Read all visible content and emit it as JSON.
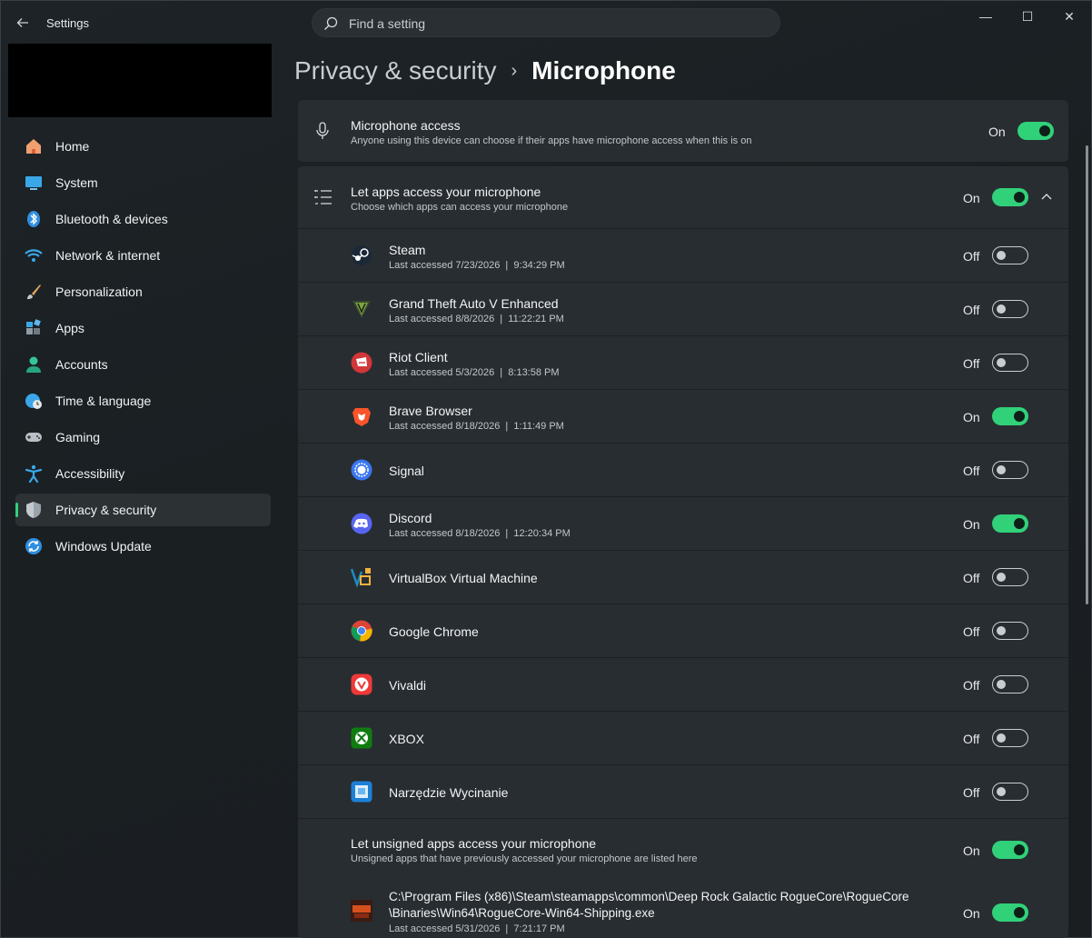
{
  "window": {
    "app_title": "Settings",
    "back_icon": "back-arrow-icon",
    "controls": {
      "minimize": "—",
      "maximize": "☐",
      "close": "✕"
    }
  },
  "search": {
    "placeholder": "Find a setting"
  },
  "sidebar": {
    "items": [
      {
        "label": "Home",
        "icon": "home-icon"
      },
      {
        "label": "System",
        "icon": "system-icon"
      },
      {
        "label": "Bluetooth & devices",
        "icon": "bluetooth-icon"
      },
      {
        "label": "Network & internet",
        "icon": "wifi-icon"
      },
      {
        "label": "Personalization",
        "icon": "brush-icon"
      },
      {
        "label": "Apps",
        "icon": "apps-icon"
      },
      {
        "label": "Accounts",
        "icon": "account-icon"
      },
      {
        "label": "Time & language",
        "icon": "globe-clock-icon"
      },
      {
        "label": "Gaming",
        "icon": "gamepad-icon"
      },
      {
        "label": "Accessibility",
        "icon": "accessibility-icon"
      },
      {
        "label": "Privacy & security",
        "icon": "shield-icon",
        "active": true
      },
      {
        "label": "Windows Update",
        "icon": "update-icon"
      }
    ]
  },
  "breadcrumb": {
    "parent": "Privacy & security",
    "separator": "›",
    "current": "Microphone"
  },
  "microphone_access": {
    "title": "Microphone access",
    "subtitle": "Anyone using this device can choose if their apps have microphone access when this is on",
    "state": "On"
  },
  "let_apps": {
    "title": "Let apps access your microphone",
    "subtitle": "Choose which apps can access your microphone",
    "state": "On",
    "expand_icon": "chevron-up-icon"
  },
  "apps": [
    {
      "name": "Steam",
      "last": "Last accessed 7/23/2026  |  9:34:29 PM",
      "state": "Off",
      "icon": "steam-icon"
    },
    {
      "name": "Grand Theft Auto V Enhanced",
      "last": "Last accessed 8/8/2026  |  11:22:21 PM",
      "state": "Off",
      "icon": "gta-icon"
    },
    {
      "name": "Riot Client",
      "last": "Last accessed 5/3/2026  |  8:13:58 PM",
      "state": "Off",
      "icon": "riot-icon"
    },
    {
      "name": "Brave Browser",
      "last": "Last accessed 8/18/2026  |  1:11:49 PM",
      "state": "On",
      "icon": "brave-icon"
    },
    {
      "name": "Signal",
      "last": "",
      "state": "Off",
      "icon": "signal-icon"
    },
    {
      "name": "Discord",
      "last": "Last accessed 8/18/2026  |  12:20:34 PM",
      "state": "On",
      "icon": "discord-icon"
    },
    {
      "name": "VirtualBox Virtual Machine",
      "last": "",
      "state": "Off",
      "icon": "virtualbox-icon"
    },
    {
      "name": "Google Chrome",
      "last": "",
      "state": "Off",
      "icon": "chrome-icon"
    },
    {
      "name": "Vivaldi",
      "last": "",
      "state": "Off",
      "icon": "vivaldi-icon"
    },
    {
      "name": "XBOX",
      "last": "",
      "state": "Off",
      "icon": "xbox-icon"
    },
    {
      "name": "Narzędzie Wycinanie",
      "last": "",
      "state": "Off",
      "icon": "snipping-tool-icon"
    }
  ],
  "unsigned": {
    "title": "Let unsigned apps access your microphone",
    "subtitle": "Unsigned apps that have previously accessed your microphone are listed here",
    "state": "On"
  },
  "unsigned_apps": [
    {
      "path_line1": "C:\\Program Files (x86)\\Steam\\steamapps\\common\\Deep Rock Galactic RogueCore\\RogueCore",
      "path_line2": "\\Binaries\\Win64\\RogueCore-Win64-Shipping.exe",
      "last": "Last accessed 5/31/2026  |  7:21:17 PM",
      "state": "On",
      "icon": "roguecore-icon"
    }
  ],
  "colors": {
    "accent": "#31d17a",
    "card": "#282d31",
    "background": "#1b2024"
  }
}
